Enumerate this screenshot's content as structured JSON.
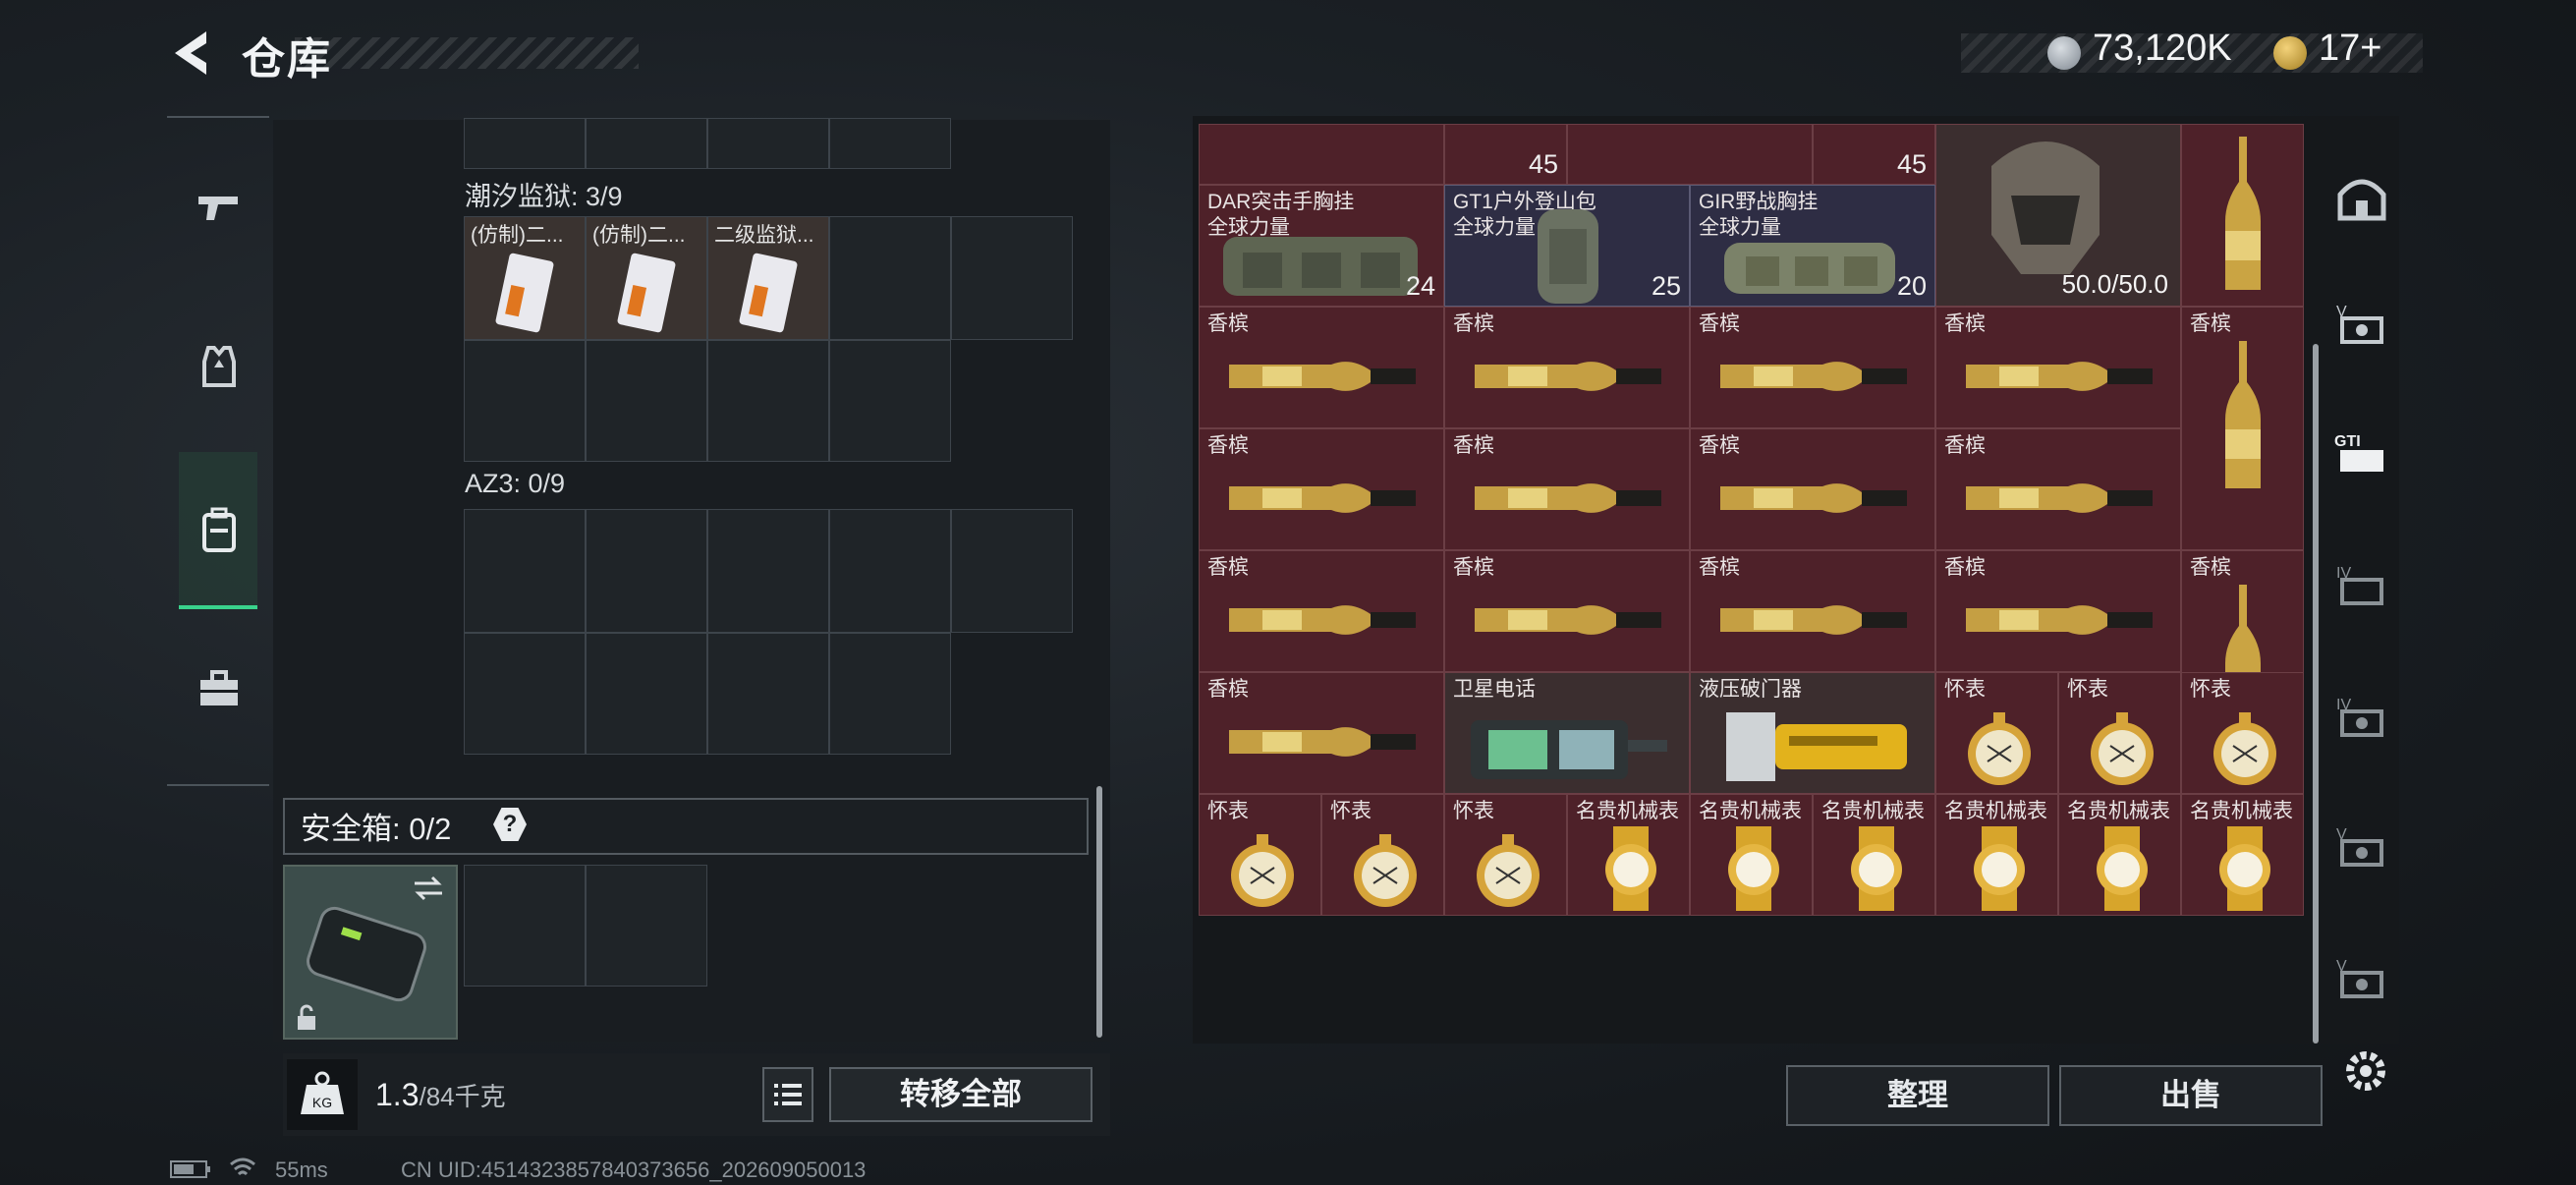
{
  "header": {
    "title": "仓库",
    "currency": {
      "coins": "73,120K",
      "bonds": "17+"
    }
  },
  "left_rail": {
    "items": [
      "pistol",
      "vest",
      "backpack",
      "case"
    ],
    "active": "backpack"
  },
  "left_panel": {
    "section1": {
      "label": "潮汐监狱: 3/9",
      "items": [
        "(仿制)二...",
        "(仿制)二...",
        "二级监狱..."
      ]
    },
    "section2": {
      "label": "AZ3: 0/9"
    },
    "safe": {
      "label": "安全箱: 0/2",
      "help": "?"
    },
    "weight": {
      "value": "1.3",
      "unit": "/84千克"
    },
    "transfer_label": "转移全部"
  },
  "stash": {
    "top_badges": [
      "45",
      "45"
    ],
    "helmet_durability": "50.0/50.0",
    "r1": [
      {
        "name": "DAR突击手胸挂\n全球力量",
        "badge": "24"
      },
      {
        "name": "GT1户外登山包\n全球力量",
        "badge": "25"
      },
      {
        "name": "GIR野战胸挂\n全球力量",
        "badge": "20"
      }
    ],
    "champagne": "香槟",
    "satphone": "卫星电话",
    "breacher": "液压破门器",
    "pocketwatch": "怀表",
    "luxwatch": "名贵机械表"
  },
  "buttons": {
    "sort": "整理",
    "sell": "出售"
  },
  "status": {
    "ping": "55ms",
    "uid": "CN UID:4514323857840373656_202609050013"
  },
  "colors": {
    "cell_red": "#4e2129",
    "cell_blue": "#2e2d44",
    "accent": "#39d38c"
  }
}
